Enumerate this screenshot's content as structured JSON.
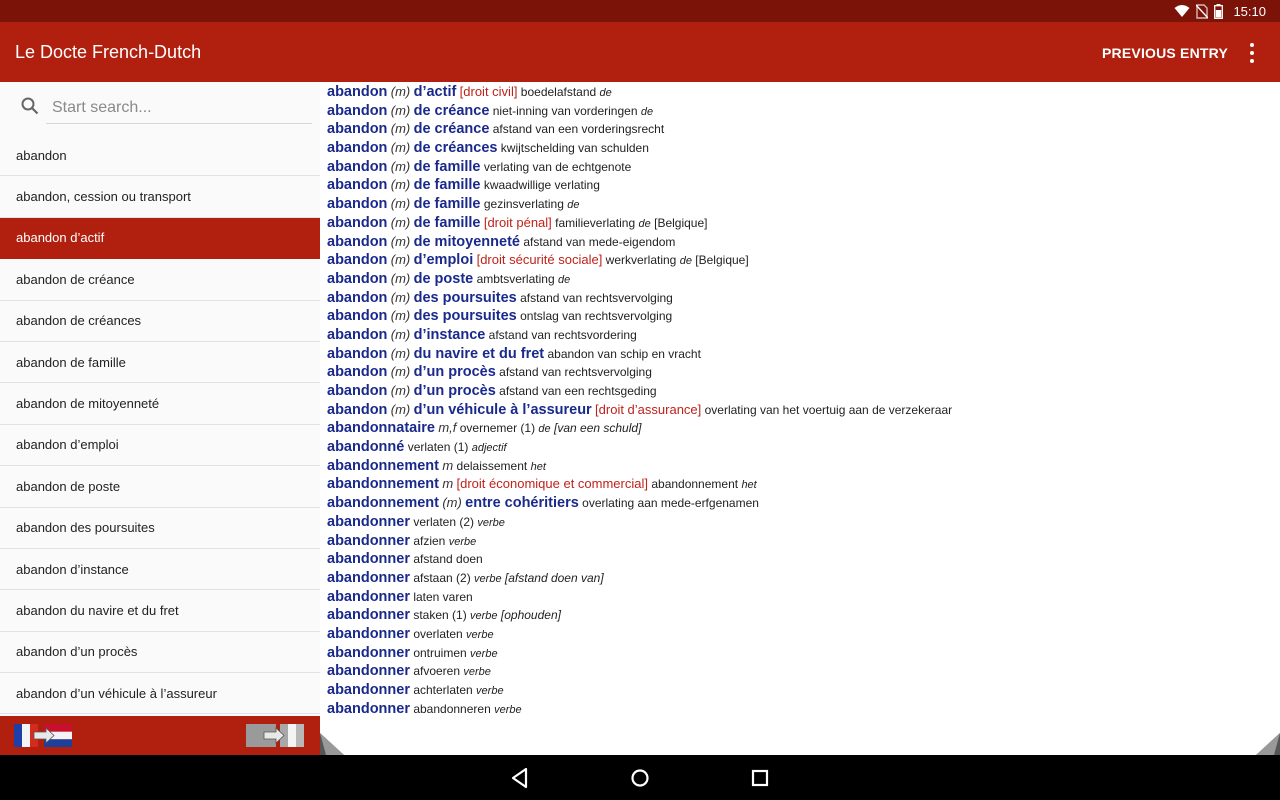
{
  "status_bar": {
    "time": "15:10"
  },
  "app_bar": {
    "title": "Le Docte French-Dutch",
    "previous_entry": "PREVIOUS ENTRY"
  },
  "search": {
    "placeholder": "Start search..."
  },
  "word_list": {
    "selected_index": 2,
    "items": [
      "abandon",
      "abandon, cession ou transport",
      "abandon d’actif",
      "abandon de créance",
      "abandon de créances",
      "abandon de famille",
      "abandon de mitoyenneté",
      "abandon d’emploi",
      "abandon de poste",
      "abandon des poursuites",
      "abandon d’instance",
      "abandon du navire et du fret",
      "abandon d’un procès",
      "abandon d’un véhicule à l’assureur"
    ]
  },
  "flags": {
    "french_to_dutch": "flag-fr-to-nl-icon",
    "dutch_to_french": "flag-nl-to-fr-icon"
  },
  "colors": {
    "status_bar": "#7b1308",
    "app_bar": "#b1200e",
    "headword": "#1a2a8c",
    "domain": "#c0221a"
  },
  "entries": [
    [
      [
        "hw",
        "abandon"
      ],
      [
        "gr",
        "(m)"
      ],
      [
        "hw",
        "d’actif"
      ],
      [
        "dom",
        "[droit civil]"
      ],
      [
        "tr",
        "boedelafstand"
      ],
      [
        "gn",
        "de"
      ]
    ],
    [
      [
        "hw",
        "abandon"
      ],
      [
        "gr",
        "(m)"
      ],
      [
        "hw",
        "de créance"
      ],
      [
        "tr",
        "niet-inning van vorderingen"
      ],
      [
        "gn",
        "de"
      ]
    ],
    [
      [
        "hw",
        "abandon"
      ],
      [
        "gr",
        "(m)"
      ],
      [
        "hw",
        "de créance"
      ],
      [
        "tr",
        "afstand van een vorderingsrecht"
      ]
    ],
    [
      [
        "hw",
        "abandon"
      ],
      [
        "gr",
        "(m)"
      ],
      [
        "hw",
        "de créances"
      ],
      [
        "tr",
        "kwijtschelding van schulden"
      ]
    ],
    [
      [
        "hw",
        "abandon"
      ],
      [
        "gr",
        "(m)"
      ],
      [
        "hw",
        "de famille"
      ],
      [
        "tr",
        "verlating van de echtgenote"
      ]
    ],
    [
      [
        "hw",
        "abandon"
      ],
      [
        "gr",
        "(m)"
      ],
      [
        "hw",
        "de famille"
      ],
      [
        "tr",
        "kwaadwillige verlating"
      ]
    ],
    [
      [
        "hw",
        "abandon"
      ],
      [
        "gr",
        "(m)"
      ],
      [
        "hw",
        "de famille"
      ],
      [
        "tr",
        "gezinsverlating"
      ],
      [
        "gn",
        "de"
      ]
    ],
    [
      [
        "hw",
        "abandon"
      ],
      [
        "gr",
        "(m)"
      ],
      [
        "hw",
        "de famille"
      ],
      [
        "dom",
        "[droit pénal]"
      ],
      [
        "tr",
        "familieverlating"
      ],
      [
        "gn",
        "de"
      ],
      [
        "tr",
        "[Belgique]"
      ]
    ],
    [
      [
        "hw",
        "abandon"
      ],
      [
        "gr",
        "(m)"
      ],
      [
        "hw",
        "de mitoyenneté"
      ],
      [
        "tr",
        "afstand van mede-eigendom"
      ]
    ],
    [
      [
        "hw",
        "abandon"
      ],
      [
        "gr",
        "(m)"
      ],
      [
        "hw",
        "d’emploi"
      ],
      [
        "dom",
        "[droit sécurité sociale]"
      ],
      [
        "tr",
        "werkverlating"
      ],
      [
        "gn",
        "de"
      ],
      [
        "tr",
        "[Belgique]"
      ]
    ],
    [
      [
        "hw",
        "abandon"
      ],
      [
        "gr",
        "(m)"
      ],
      [
        "hw",
        "de poste"
      ],
      [
        "tr",
        "ambtsverlating"
      ],
      [
        "gn",
        "de"
      ]
    ],
    [
      [
        "hw",
        "abandon"
      ],
      [
        "gr",
        "(m)"
      ],
      [
        "hw",
        "des poursuites"
      ],
      [
        "tr",
        "afstand van rechtsvervolging"
      ]
    ],
    [
      [
        "hw",
        "abandon"
      ],
      [
        "gr",
        "(m)"
      ],
      [
        "hw",
        "des poursuites"
      ],
      [
        "tr",
        "ontslag van rechtsvervolging"
      ]
    ],
    [
      [
        "hw",
        "abandon"
      ],
      [
        "gr",
        "(m)"
      ],
      [
        "hw",
        "d’instance"
      ],
      [
        "tr",
        "afstand van rechtsvordering"
      ]
    ],
    [
      [
        "hw",
        "abandon"
      ],
      [
        "gr",
        "(m)"
      ],
      [
        "hw",
        "du navire et du fret"
      ],
      [
        "tr",
        "abandon van schip en vracht"
      ]
    ],
    [
      [
        "hw",
        "abandon"
      ],
      [
        "gr",
        "(m)"
      ],
      [
        "hw",
        "d’un procès"
      ],
      [
        "tr",
        "afstand van rechtsvervolging"
      ]
    ],
    [
      [
        "hw",
        "abandon"
      ],
      [
        "gr",
        "(m)"
      ],
      [
        "hw",
        "d’un procès"
      ],
      [
        "tr",
        "afstand van een rechtsgeding"
      ]
    ],
    [
      [
        "hw",
        "abandon"
      ],
      [
        "gr",
        "(m)"
      ],
      [
        "hw",
        "d’un véhicule à l’assureur"
      ],
      [
        "dom",
        "[droit d’assurance]"
      ],
      [
        "tr",
        "overlating van het voertuig aan de verzekeraar"
      ]
    ],
    [
      [
        "hw",
        "abandonnataire"
      ],
      [
        "gr",
        "m,f"
      ],
      [
        "tr",
        "overnemer (1)"
      ],
      [
        "gn",
        "de"
      ],
      [
        "ex",
        "[van een schuld]"
      ]
    ],
    [
      [
        "hw",
        "abandonné"
      ],
      [
        "tr",
        "verlaten (1)"
      ],
      [
        "gn",
        "adjectif"
      ]
    ],
    [
      [
        "hw",
        "abandonnement"
      ],
      [
        "gr",
        "m"
      ],
      [
        "tr",
        "delaissement"
      ],
      [
        "gn",
        "het"
      ]
    ],
    [
      [
        "hw",
        "abandonnement"
      ],
      [
        "gr",
        "m"
      ],
      [
        "dom",
        "[droit économique et commercial]"
      ],
      [
        "tr",
        "abandonnement"
      ],
      [
        "gn",
        "het"
      ]
    ],
    [
      [
        "hw",
        "abandonnement"
      ],
      [
        "gr",
        "(m)"
      ],
      [
        "hw",
        "entre cohéritiers"
      ],
      [
        "tr",
        "overlating aan mede-erfgenamen"
      ]
    ],
    [
      [
        "hw",
        "abandonner"
      ],
      [
        "tr",
        "verlaten (2)"
      ],
      [
        "gn",
        "verbe"
      ]
    ],
    [
      [
        "hw",
        "abandonner"
      ],
      [
        "tr",
        "afzien"
      ],
      [
        "gn",
        "verbe"
      ]
    ],
    [
      [
        "hw",
        "abandonner"
      ],
      [
        "tr",
        "afstand doen"
      ]
    ],
    [
      [
        "hw",
        "abandonner"
      ],
      [
        "tr",
        "afstaan (2)"
      ],
      [
        "gn",
        "verbe"
      ],
      [
        "ex",
        "[afstand doen van]"
      ]
    ],
    [
      [
        "hw",
        "abandonner"
      ],
      [
        "tr",
        "laten varen"
      ]
    ],
    [
      [
        "hw",
        "abandonner"
      ],
      [
        "tr",
        "staken (1)"
      ],
      [
        "gn",
        "verbe"
      ],
      [
        "ex",
        "[ophouden]"
      ]
    ],
    [
      [
        "hw",
        "abandonner"
      ],
      [
        "tr",
        "overlaten"
      ],
      [
        "gn",
        "verbe"
      ]
    ],
    [
      [
        "hw",
        "abandonner"
      ],
      [
        "tr",
        "ontruimen"
      ],
      [
        "gn",
        "verbe"
      ]
    ],
    [
      [
        "hw",
        "abandonner"
      ],
      [
        "tr",
        "afvoeren"
      ],
      [
        "gn",
        "verbe"
      ]
    ],
    [
      [
        "hw",
        "abandonner"
      ],
      [
        "tr",
        "achterlaten"
      ],
      [
        "gn",
        "verbe"
      ]
    ],
    [
      [
        "hw",
        "abandonner"
      ],
      [
        "tr",
        "abandonneren"
      ],
      [
        "gn",
        "verbe"
      ]
    ]
  ]
}
